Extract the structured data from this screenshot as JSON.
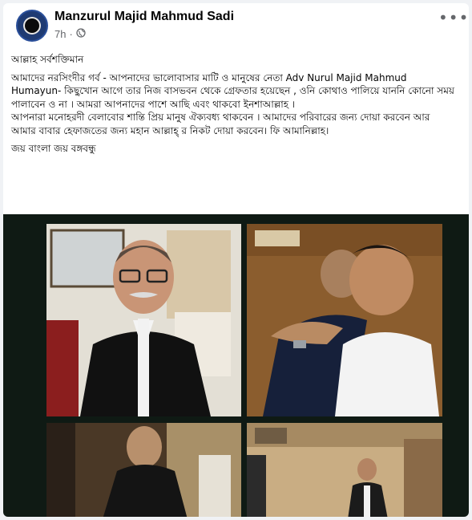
{
  "post": {
    "author": "Manzurul Majid Mahmud Sadi",
    "time": "7h",
    "meta_separator": "·",
    "privacy_icon": "globe-icon",
    "more_icon": "more-options-icon",
    "body": [
      "আল্লাহ সর্বশক্তিমান",
      "আমাদের নরসিংদীর গর্ব - আপনাদের ভালোবাসার মাটি ও মানুষের নেতা Adv Nurul Majid Mahmud Humayun- কিছুখোন আগে তার নিজ বাসভবন থেকে গ্রেফতার হয়েছেন , ওনি কোথাও পালিয়ে যাননি কোনো সময় পালাবেন ও না । আমরা আপনাদের পাশে আছি এবং থাকবো ইনশাআল্লাহ ।",
      "আপনারা মনোহরদী বেলাবোর শান্তি প্রিয় মানুষ ঐক্যবধ্য থাকবেন । আমাদের পরিবারের জন্য দোয়া করবেন আর আমার  বাবার হেফাজতের জন্য মহান আল্লাহ্‌ র  নিকট দোয়া করবেন। ফি আমানিল্লাহ।",
      "জয় বাংলা জয় বঙ্গবন্ধু"
    ]
  },
  "colors": {
    "name": "#050505",
    "meta": "#65676b",
    "photo_background": "#0f1a14"
  }
}
